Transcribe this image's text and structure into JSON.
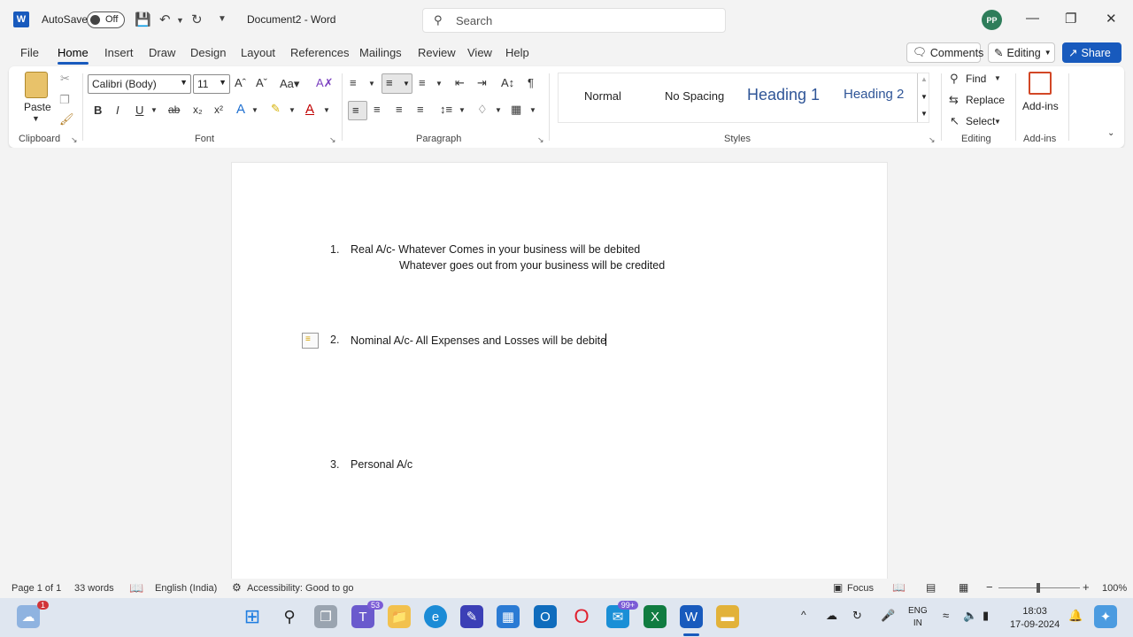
{
  "titlebar": {
    "autosave_label": "AutoSave",
    "autosave_state": "Off",
    "doc_title": "Document2  -  Word",
    "search_placeholder": "Search",
    "avatar_initials": "PP"
  },
  "menu": {
    "tabs": [
      "File",
      "Home",
      "Insert",
      "Draw",
      "Design",
      "Layout",
      "References",
      "Mailings",
      "Review",
      "View",
      "Help"
    ],
    "active_tab": "Home",
    "comments_label": "Comments",
    "editing_label": "Editing",
    "share_label": "Share"
  },
  "ribbon": {
    "clipboard": {
      "paste_label": "Paste",
      "group_label": "Clipboard"
    },
    "font": {
      "font_name": "Calibri (Body)",
      "font_size": "11",
      "group_label": "Font"
    },
    "paragraph": {
      "group_label": "Paragraph"
    },
    "styles": {
      "items": [
        "Normal",
        "No Spacing",
        "Heading 1",
        "Heading 2"
      ],
      "group_label": "Styles"
    },
    "editing": {
      "find_label": "Find",
      "replace_label": "Replace",
      "select_label": "Select",
      "group_label": "Editing"
    },
    "addins": {
      "button_label": "Add-ins",
      "group_label": "Add-ins"
    }
  },
  "document": {
    "items": [
      {
        "number": "1.",
        "line1": "Real A/c- Whatever Comes in your business will be debited",
        "line2": "Whatever goes out from your business will be credited"
      },
      {
        "number": "2.",
        "line1": "Nominal A/c- All Expenses and Losses will be debite"
      },
      {
        "number": "3.",
        "line1": "Personal A/c"
      }
    ]
  },
  "statusbar": {
    "page": "Page 1 of 1",
    "words": "33 words",
    "language": "English (India)",
    "accessibility": "Accessibility: Good to go",
    "focus": "Focus",
    "zoom": "100%"
  },
  "taskbar": {
    "weather_badge": "1",
    "teams_badge": "53",
    "store_badge": "99+",
    "lang_line1": "ENG",
    "lang_line2": "IN",
    "time": "18:03",
    "date": "17-09-2024"
  },
  "colors": {
    "word_blue": "#185abd",
    "heading_blue": "#2f5597"
  }
}
